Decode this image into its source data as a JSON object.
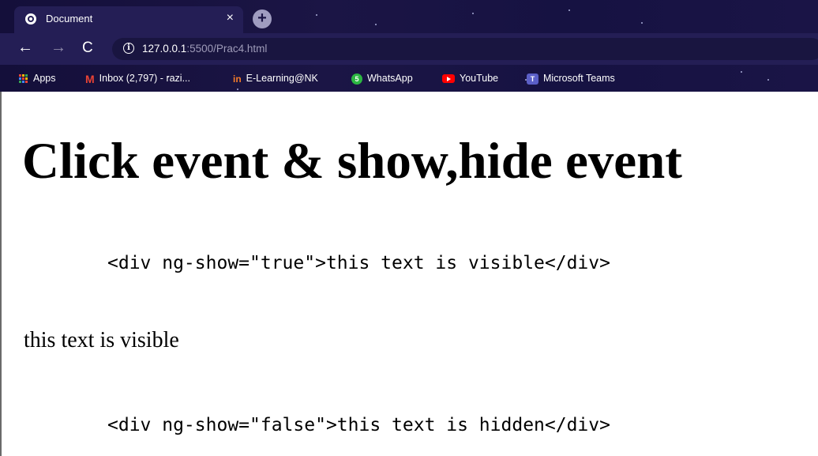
{
  "browser": {
    "tab": {
      "title": "Document",
      "close_glyph": "×"
    },
    "new_tab_glyph": "+",
    "nav": {
      "back_glyph": "←",
      "forward_glyph": "→",
      "reload_glyph": "C"
    },
    "address": {
      "info_glyph": "i",
      "host": "127.0.0.1",
      "rest": ":5500/Prac4.html"
    },
    "bookmarks": [
      {
        "label": "Apps",
        "icon": "apps-grid-icon"
      },
      {
        "label": "Inbox (2,797) - razi...",
        "icon": "gmail-icon",
        "glyph": "M"
      },
      {
        "label": "E-Learning@NK",
        "icon": "elearning-icon",
        "glyph": "in"
      },
      {
        "label": "WhatsApp",
        "icon": "whatsapp-icon",
        "glyph": "5"
      },
      {
        "label": "YouTube",
        "icon": "youtube-icon"
      },
      {
        "label": "Microsoft Teams",
        "icon": "teams-icon",
        "glyph": "T"
      }
    ]
  },
  "page": {
    "heading": "Click event & show,hide event",
    "code_show": "<div ng-show=\"true\">this text is visible</div>",
    "visible_text": "this text is visible",
    "code_hide": "<div ng-show=\"false\">this text is hidden</div>"
  },
  "colors": {
    "chrome_bg": "#1b1545",
    "toolbar_bg": "#241e55",
    "omnibox_bg": "#191540",
    "gmail_red": "#ea4335",
    "whatsapp_green": "#2cb742",
    "youtube_red": "#ff0000",
    "teams_purple": "#5b5fc7"
  }
}
